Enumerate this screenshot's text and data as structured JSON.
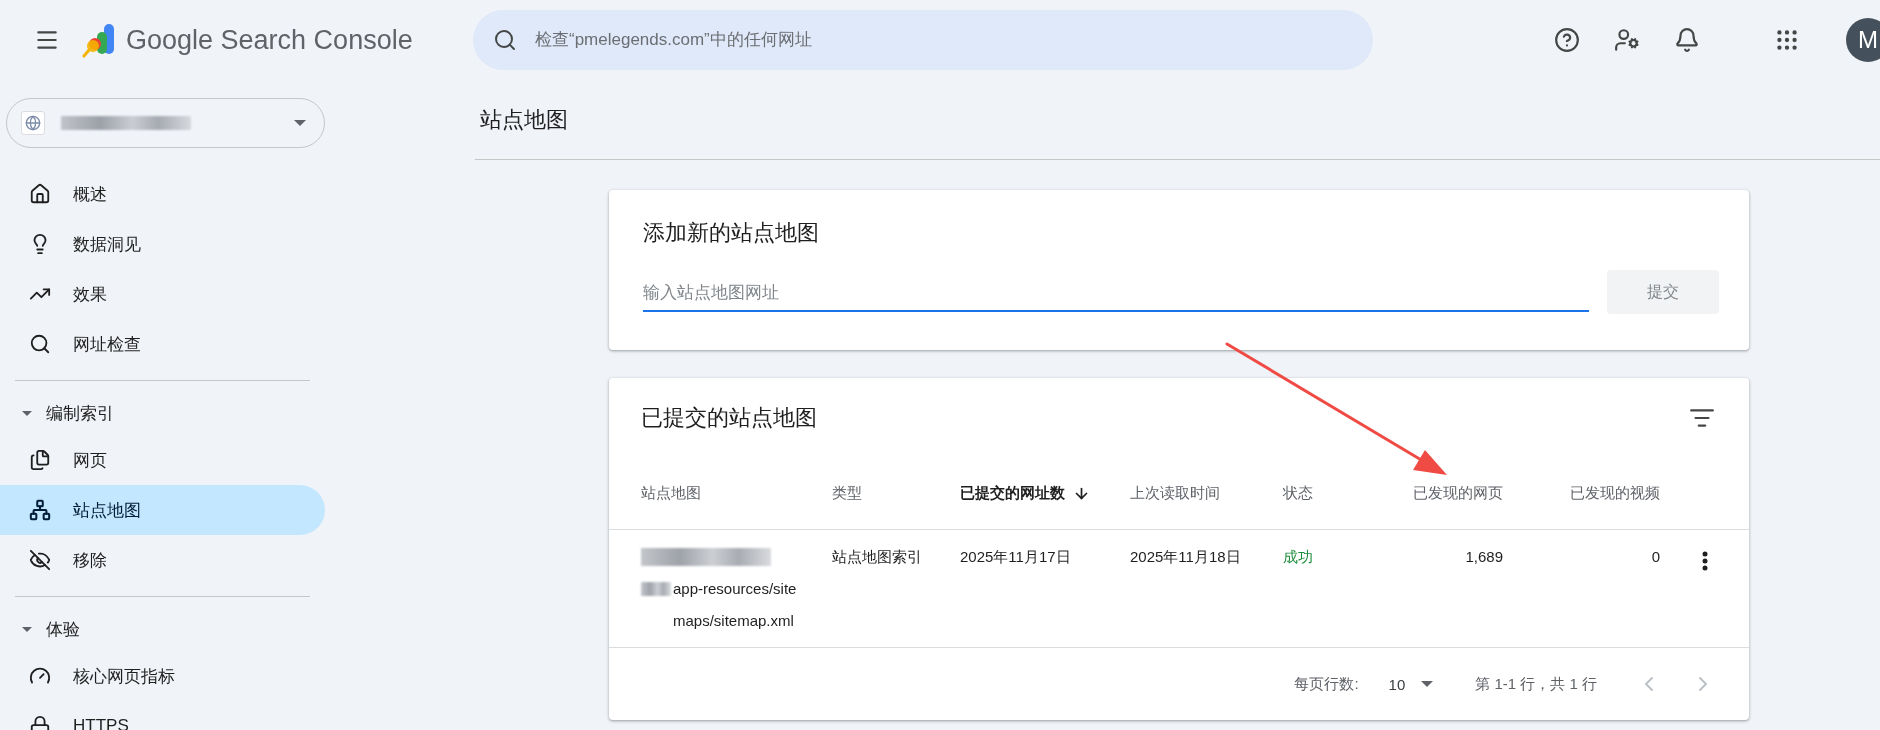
{
  "header": {
    "product_name": "Google Search Console",
    "search": {
      "placeholder": "检查“pmelegends.com”中的任何网址"
    },
    "avatar_initial": "M"
  },
  "sidebar": {
    "items": [
      {
        "label": "概述",
        "selected": false
      },
      {
        "label": "数据洞见",
        "selected": false
      },
      {
        "label": "效果",
        "selected": false
      },
      {
        "label": "网址检查",
        "selected": false
      }
    ],
    "sections": [
      {
        "label": "编制索引",
        "expanded": true,
        "items": [
          {
            "label": "网页",
            "selected": false
          },
          {
            "label": "站点地图",
            "selected": true
          },
          {
            "label": "移除",
            "selected": false
          }
        ]
      },
      {
        "label": "体验",
        "expanded": true,
        "items": [
          {
            "label": "核心网页指标",
            "selected": false
          },
          {
            "label": "HTTPS",
            "selected": false
          }
        ]
      }
    ]
  },
  "page_title": "站点地图",
  "add_sitemap": {
    "title": "添加新的站点地图",
    "input": {
      "placeholder": "输入站点地图网址",
      "focused": true
    },
    "submit": {
      "label": "提交",
      "disabled": true
    }
  },
  "submitted_sitemaps": {
    "title": "已提交的站点地图",
    "columns": [
      {
        "label": "站点地图",
        "sorted": false
      },
      {
        "label": "类型",
        "sorted": false
      },
      {
        "label": "已提交的网址数",
        "sorted": true
      },
      {
        "label": "上次读取时间",
        "sorted": false
      },
      {
        "label": "状态",
        "sorted": false
      },
      {
        "label": "已发现的网页",
        "sorted": false
      },
      {
        "label": "已发现的视频",
        "sorted": false
      }
    ],
    "rows": [
      {
        "sitemap": "app-resources/sitemaps/sitemap.xml",
        "type": "站点地图索引",
        "submitted": "2025年11月17日",
        "last_read": "2025年11月18日",
        "status": {
          "text": "成功",
          "color": "#1e8e3e"
        },
        "discovered_pages": "1,689",
        "discovered_videos": "0"
      }
    ],
    "pagination": {
      "rows_per_page_label": "每页行数:",
      "rows_per_page": "10",
      "range": "第 1-1 行，共 1 行",
      "prev": {
        "disabled": true
      },
      "next": {
        "disabled": true
      }
    }
  }
}
